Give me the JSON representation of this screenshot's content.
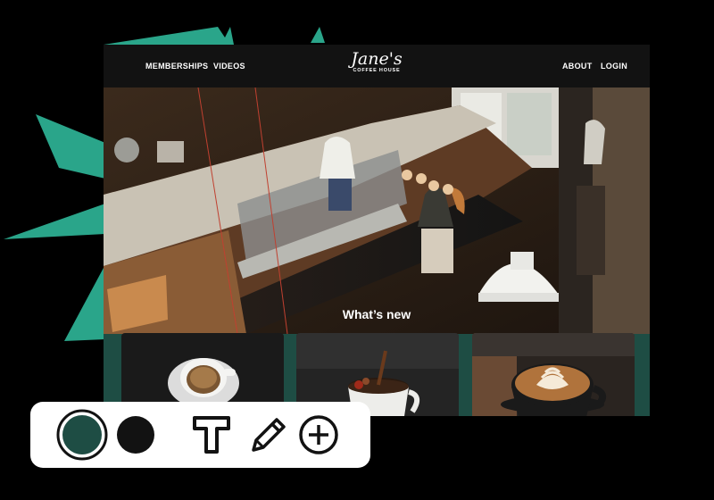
{
  "site": {
    "nav_left": [
      "MEMBERSHIPS",
      "VIDEOS"
    ],
    "nav_right": [
      "ABOUT",
      "LOGIN"
    ],
    "logo_script": "Jane's",
    "logo_sub": "COFFEE HOUSE",
    "section_title": "What’s new"
  },
  "cards": [
    {
      "subject": "espresso-cup"
    },
    {
      "subject": "coffee-pour"
    },
    {
      "subject": "latte-art"
    }
  ],
  "toolbar": {
    "colors": [
      "#1e4d44",
      "#121212"
    ],
    "tools": [
      "text-tool-icon",
      "pencil-icon",
      "add-circle-icon"
    ]
  },
  "colors": {
    "accent": "#2aa58a",
    "header_bg": "#121212",
    "section_bg": "#1e4d44"
  }
}
